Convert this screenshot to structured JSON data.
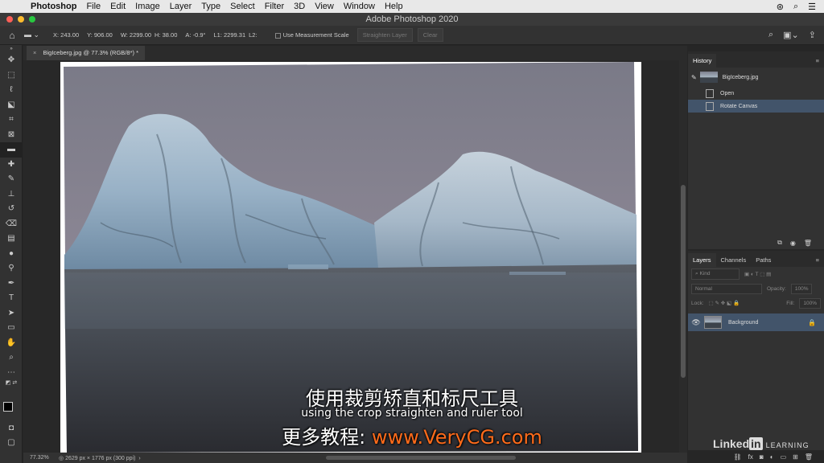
{
  "menubar": {
    "app": "Photoshop",
    "items": [
      "File",
      "Edit",
      "Image",
      "Layer",
      "Type",
      "Select",
      "Filter",
      "3D",
      "View",
      "Window",
      "Help"
    ]
  },
  "window": {
    "title": "Adobe Photoshop 2020"
  },
  "options": {
    "x": "X: 243.00",
    "y": "Y: 906.00",
    "w": "W: 2299.00",
    "h": "H: 38.00",
    "a": "A: -0.9°",
    "l1": "L1: 2299.31",
    "l2": "L2:",
    "measurement_label": "Use Measurement Scale",
    "straighten_label": "Straighten Layer",
    "clear_label": "Clear"
  },
  "document": {
    "tab_label": "BigIceberg.jpg @ 77.3% (RGB/8*) *",
    "zoom": "77.32%",
    "doc_info": "2629 px × 1776 px (300 ppi)"
  },
  "subtitles": {
    "line1": "使用裁剪矫直和标尺工具",
    "line2": "using the crop straighten and ruler tool",
    "line3_prefix": "更多教程: ",
    "line3_url": "www.VeryCG.com"
  },
  "history": {
    "tab": "History",
    "snapshot": "BigIceberg.jpg",
    "states": [
      "Open",
      "Rotate Canvas"
    ]
  },
  "layers": {
    "tabs": [
      "Layers",
      "Channels",
      "Paths"
    ],
    "kind_placeholder": "Kind",
    "blend_mode": "Normal",
    "opacity_label": "Opacity:",
    "opacity_value": "100%",
    "lock_label": "Lock:",
    "fill_label": "Fill:",
    "fill_value": "100%",
    "layer_name": "Background"
  },
  "branding": {
    "linkedin": "Linked",
    "in": "in",
    "learning": "LEARNING"
  },
  "colors": {
    "menubar_bg": "#e8e8e8",
    "panel_bg": "#323232",
    "selection": "#42546a",
    "url_orange": "#ff6b1a"
  }
}
